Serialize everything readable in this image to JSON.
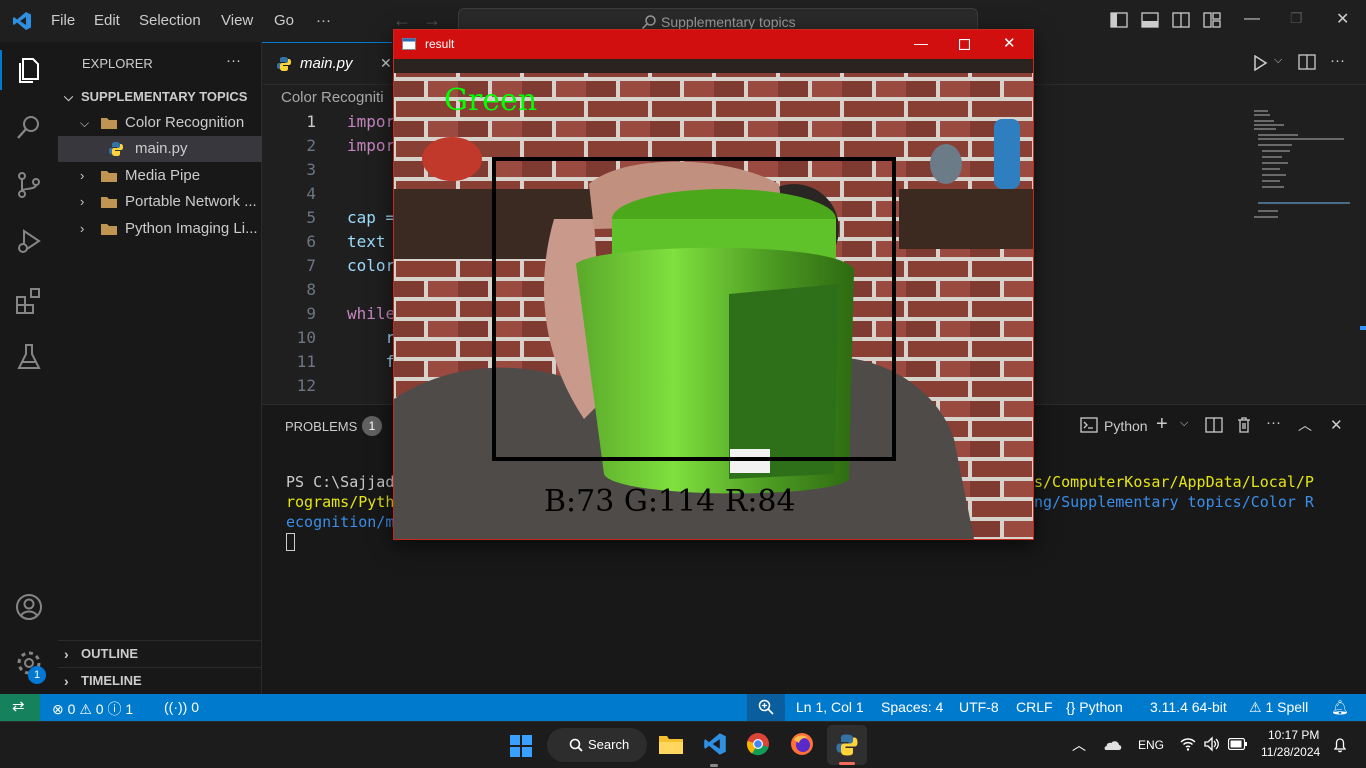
{
  "titlebar": {
    "menus": [
      "File",
      "Edit",
      "Selection",
      "View",
      "Go",
      "···"
    ],
    "search_text": "Supplementary topics"
  },
  "sidebar": {
    "header": "EXPLORER",
    "more": "···",
    "root": "SUPPLEMENTARY TOPICS",
    "items": [
      {
        "label": "Color Recognition",
        "type": "folder",
        "expanded": true
      },
      {
        "label": "main.py",
        "type": "file"
      },
      {
        "label": "Media Pipe",
        "type": "folder"
      },
      {
        "label": "Portable Network ...",
        "type": "folder"
      },
      {
        "label": "Python Imaging Li...",
        "type": "folder"
      }
    ],
    "outline": "OUTLINE",
    "timeline": "TIMELINE"
  },
  "activity": {
    "settings_badge": "1"
  },
  "editor": {
    "tab_label": "main.py",
    "tab_close": "✕",
    "breadcrumb": "Color Recogniti",
    "lines": [
      {
        "n": "1",
        "text": "impor",
        "kw": true
      },
      {
        "n": "2",
        "text": "impor",
        "kw": true
      },
      {
        "n": "3",
        "text": ""
      },
      {
        "n": "4",
        "text": ""
      },
      {
        "n": "5",
        "text": "cap ="
      },
      {
        "n": "6",
        "text": "text "
      },
      {
        "n": "7",
        "text": "color"
      },
      {
        "n": "8",
        "text": ""
      },
      {
        "n": "9",
        "text": "while",
        "kw": true
      },
      {
        "n": "10",
        "text": "    r"
      },
      {
        "n": "11",
        "text": "    f"
      },
      {
        "n": "12",
        "text": ""
      }
    ]
  },
  "panel": {
    "problems_label": "PROBLEMS",
    "problems_count": "1",
    "terminal_name": "Python",
    "term_left": [
      "PS C:\\Sajjad",
      "rograms/Pyth",
      "ecognition/m"
    ],
    "term_right_1": "s/ComputerKosar/AppData/Local/P",
    "term_right_2": "ng/Supplementary topics/Color R"
  },
  "statusbar": {
    "errors": "0",
    "warnings": "0",
    "info": "1",
    "ports": "0",
    "position": "Ln 1, Col 1",
    "spaces": "Spaces: 4",
    "encoding": "UTF-8",
    "eol": "CRLF",
    "language": "Python",
    "interpreter": "3.11.4 64-bit",
    "spell": "1 Spell"
  },
  "result_window": {
    "title": "result",
    "color_label": "Green",
    "bgr_text": "B:73 G:114 R:84"
  },
  "taskbar": {
    "search": "Search",
    "lang": "ENG",
    "time": "10:17 PM",
    "date": "11/28/2024"
  },
  "colors": {
    "accent": "#007acc",
    "result_title": "#d20f0f",
    "green_label": "#00ff00"
  }
}
